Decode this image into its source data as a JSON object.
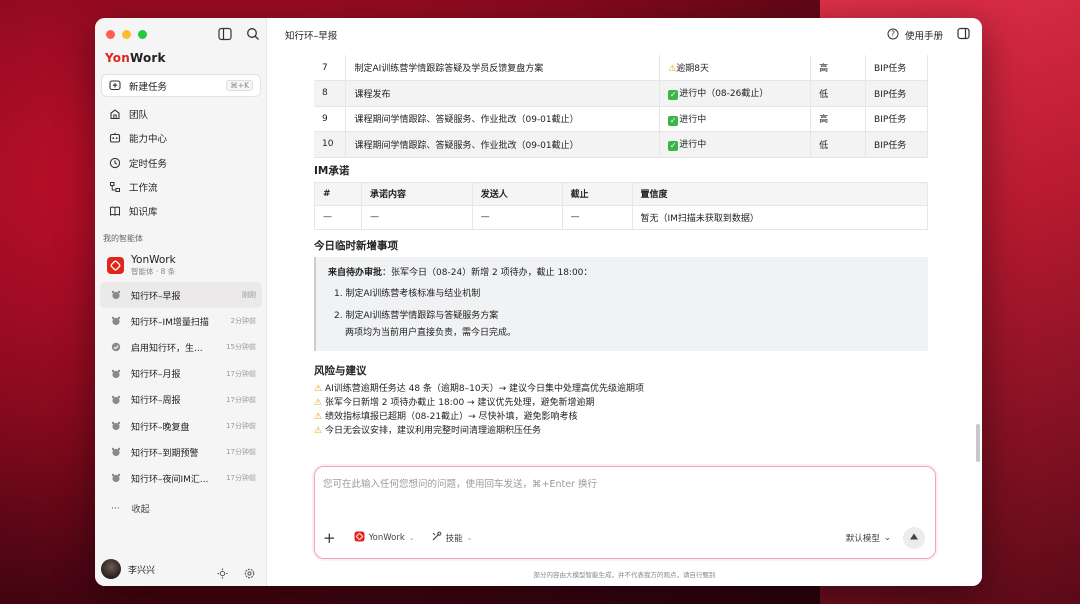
{
  "app": {
    "logo_prefix": "Yon",
    "logo_suffix": "Work",
    "new_task": "新建任务",
    "new_task_shortcut": "⌘+K"
  },
  "nav": [
    {
      "label": "团队",
      "icon": "team-icon"
    },
    {
      "label": "能力中心",
      "icon": "capability-icon"
    },
    {
      "label": "定时任务",
      "icon": "clock-icon"
    },
    {
      "label": "工作流",
      "icon": "workflow-icon"
    },
    {
      "label": "知识库",
      "icon": "book-icon"
    }
  ],
  "agents_section": "我的智能体",
  "agent": {
    "name": "YonWork",
    "sub": "智能体 · 8 条"
  },
  "chats": [
    {
      "title": "知行环–早报",
      "time": "刚刚",
      "active": true
    },
    {
      "title": "知行环–IM增量扫描",
      "time": "2分钟前"
    },
    {
      "title": "启用知行环，生...",
      "time": "15分钟前"
    },
    {
      "title": "知行环–月报",
      "time": "17分钟前"
    },
    {
      "title": "知行环–周报",
      "time": "17分钟前"
    },
    {
      "title": "知行环–晚复盘",
      "time": "17分钟前"
    },
    {
      "title": "知行环–到期预警",
      "time": "17分钟前"
    },
    {
      "title": "知行环–夜间IM汇...",
      "time": "17分钟前"
    }
  ],
  "collapse_label": "收起",
  "user": {
    "name": "李兴兴"
  },
  "header": {
    "title": "知行环–早报",
    "help": "使用手册"
  },
  "tasks": [
    {
      "no": "7",
      "name": "制定AI训练营学情跟踪答疑及学员反馈复盘方案",
      "status_icon": "warning-icon",
      "status": "逾期8天",
      "priority": "高",
      "type": "BIP任务"
    },
    {
      "no": "8",
      "name": "课程发布",
      "status_icon": "check-icon",
      "status": "进行中（08-26截止）",
      "priority": "低",
      "type": "BIP任务"
    },
    {
      "no": "9",
      "name": "课程期间学情跟踪、答疑服务、作业批改（09-01截止）",
      "status_icon": "check-icon",
      "status": "进行中",
      "priority": "高",
      "type": "BIP任务"
    },
    {
      "no": "10",
      "name": "课程期间学情跟踪、答疑服务、作业批改（09-01截止）",
      "status_icon": "check-icon",
      "status": "进行中",
      "priority": "低",
      "type": "BIP任务"
    }
  ],
  "im": {
    "title": "IM承诺",
    "headers": [
      "#",
      "承诺内容",
      "发送人",
      "截止",
      "置信度"
    ],
    "row": [
      "—",
      "—",
      "—",
      "—",
      "暂无（IM扫描未获取到数据）"
    ]
  },
  "new_items": {
    "title": "今日临时新增事项",
    "lead_bold": "来自待办审批",
    "lead_rest": "：张军今日（08-24）新增 2 项待办，截止 18:00：",
    "item1": "1. 制定AI训练营考核标准与结业机制",
    "item2": "2. 制定AI训练营学情跟踪与答疑服务方案",
    "note": "两项均为当前用户直接负责，需今日完成。"
  },
  "risks": {
    "title": "风险与建议",
    "items": [
      "AI训练营逾期任务达 48 条（逾期8–10天）→ 建议今日集中处理高优先级逾期项",
      "张军今日新增 2 项待办截止 18:00 → 建议优先处理，避免新增逾期",
      "绩效指标填报已超期（08-21截止）→ 尽快补填，避免影响考核",
      "今日无会议安排，建议利用完整时间清理逾期积压任务"
    ]
  },
  "input": {
    "placeholder": "您可在此输入任何您想问的问题，使用回车发送，⌘+Enter 换行",
    "agent_chip": "YonWork",
    "skill_chip": "技能",
    "model": "默认模型"
  },
  "footer_note": "部分内容由大模型智能生成，并不代表我方的观点，请自行甄别"
}
